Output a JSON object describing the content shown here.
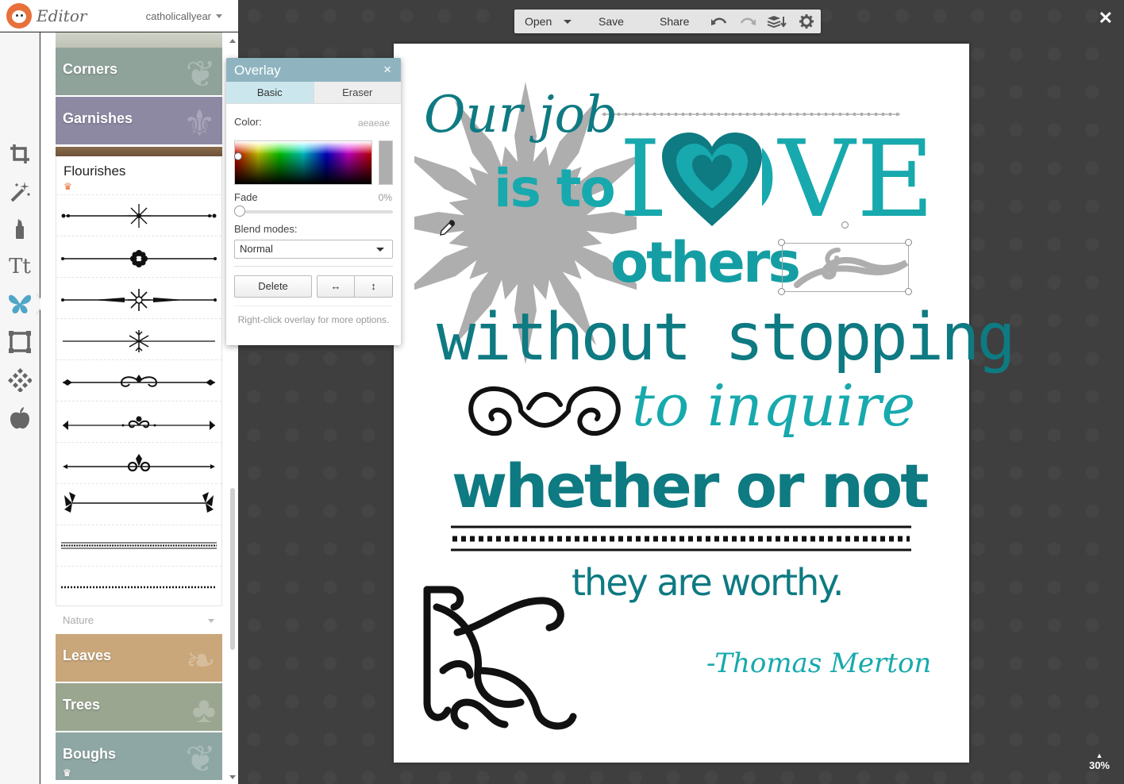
{
  "app": {
    "name": "Editor",
    "user": "catholicallyear"
  },
  "library": {
    "categories_top": [
      {
        "label": "Corners",
        "bg": "#8fa39b"
      },
      {
        "label": "Garnishes",
        "bg": "#8e89a3"
      }
    ],
    "flourishes": {
      "title": "Flourishes"
    },
    "nature_label": "Nature",
    "categories_bottom": [
      {
        "label": "Leaves",
        "bg": "#c9a77a"
      },
      {
        "label": "Trees",
        "bg": "#9aa690"
      },
      {
        "label": "Boughs",
        "bg": "#8fa7a4"
      }
    ]
  },
  "tools": [
    {
      "name": "crop-tool-icon",
      "glyph": "⧉"
    },
    {
      "name": "effects-wand-icon",
      "glyph": "✦"
    },
    {
      "name": "touch-up-icon",
      "glyph": "✎"
    },
    {
      "name": "text-tool-icon",
      "glyph": "Tt"
    },
    {
      "name": "overlays-butterfly-icon",
      "glyph": "❦"
    },
    {
      "name": "frames-icon",
      "glyph": "▢"
    },
    {
      "name": "textures-icon",
      "glyph": "▦"
    },
    {
      "name": "themes-apple-icon",
      "glyph": "●"
    }
  ],
  "overlay_panel": {
    "title": "Overlay",
    "close": "×",
    "tabs": [
      "Basic",
      "Eraser"
    ],
    "color_label": "Color:",
    "color_value": "aeaeae",
    "color_hex": "#aeaeae",
    "fade_label": "Fade",
    "fade_value": "0%",
    "blend_label": "Blend modes:",
    "blend_value": "Normal",
    "delete_label": "Delete",
    "flip_h": "↔",
    "flip_v": "↕",
    "hint": "Right-click overlay for more options."
  },
  "toolbar": {
    "open_label": "Open",
    "save_label": "Save",
    "share_label": "Share",
    "close": "✕",
    "zoom": "30%"
  },
  "artwork": {
    "line1": "Our job",
    "line2": "is to",
    "line3": "LOVE",
    "line4": "others",
    "line5": "without stopping",
    "line6": "to inquire",
    "line7": "whether or not",
    "line8": "they are worthy.",
    "attribution": "-Thomas Merton",
    "colors": {
      "teal_dark": "#0e7a82",
      "teal": "#149ea3",
      "teal_light": "#17a9ad",
      "gray": "#aeaeae",
      "black": "#111111"
    }
  }
}
